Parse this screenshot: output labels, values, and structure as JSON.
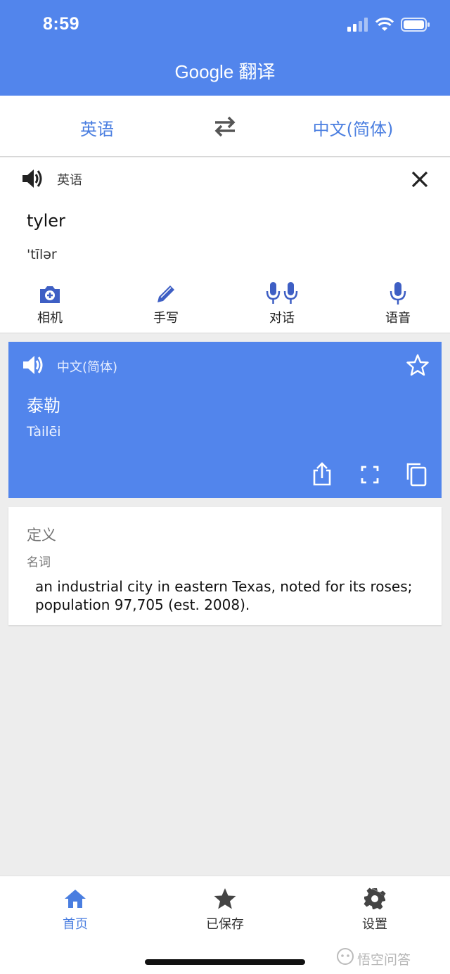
{
  "status_bar": {
    "time": "8:59"
  },
  "app": {
    "title": "Google 翻译"
  },
  "lang_bar": {
    "source": "英语",
    "target": "中文(简体)",
    "swap_icon": "swap-arrows-icon"
  },
  "input": {
    "label": "英语",
    "text": "tyler",
    "phonetic": "'tīlər",
    "tools": [
      {
        "label": "相机",
        "icon": "camera-icon"
      },
      {
        "label": "手写",
        "icon": "pen-icon"
      },
      {
        "label": "对话",
        "icon": "conversation-mic-icon"
      },
      {
        "label": "语音",
        "icon": "mic-icon"
      }
    ]
  },
  "result": {
    "label": "中文(简体)",
    "text": "泰勒",
    "phonetic": "Tàilēi",
    "accent": "#5285ec"
  },
  "definitions": {
    "title": "定义",
    "part_of_speech": "名词",
    "text": "an industrial city in eastern Texas, noted for its roses; population 97,705 (est. 2008)."
  },
  "bottom_nav": {
    "items": [
      {
        "label": "首页",
        "icon": "home-icon",
        "active": true
      },
      {
        "label": "已保存",
        "icon": "star-icon",
        "active": false
      },
      {
        "label": "设置",
        "icon": "gear-icon",
        "active": false
      }
    ]
  },
  "watermark": {
    "text": "悟空问答"
  }
}
